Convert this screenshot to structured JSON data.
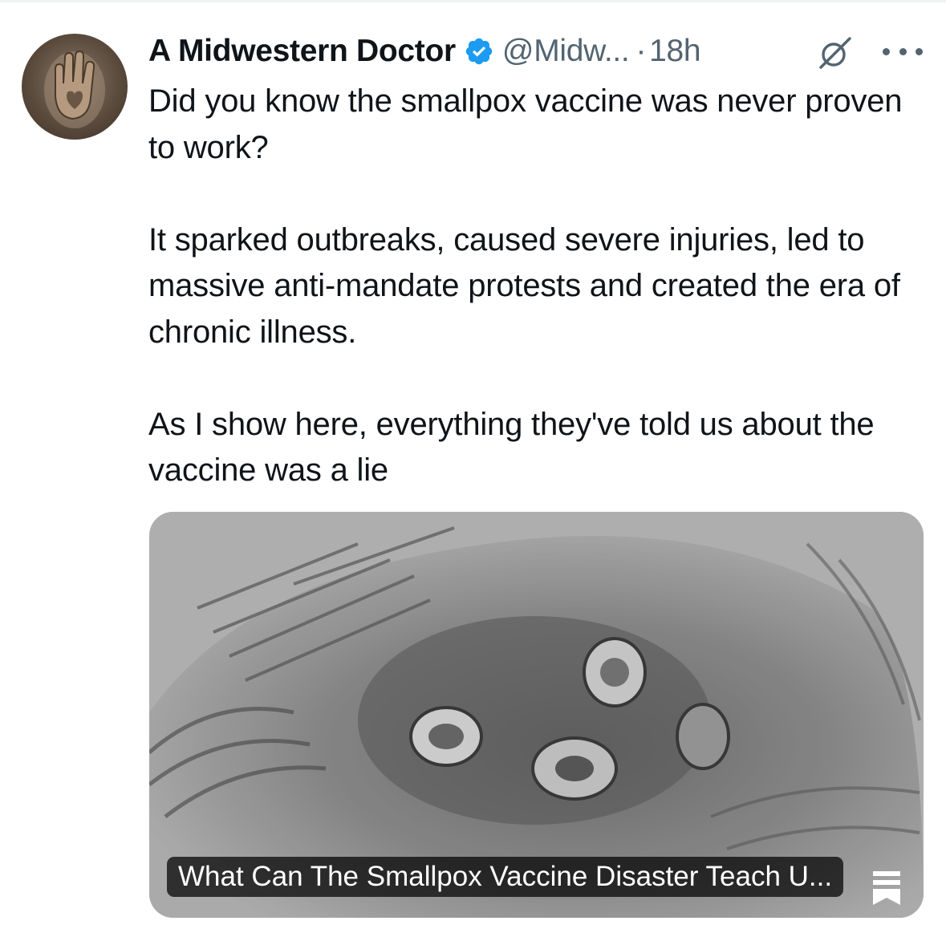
{
  "tweet": {
    "author_name": "A Midwestern Doctor",
    "handle": "@Midw...",
    "separator": "·",
    "time": "18h",
    "text": "Did you know the smallpox vaccine was never proven to work?\n\nIt sparked outbreaks, caused severe injuries, led to massive anti-mandate protests and created the era of chronic illness.\n\nAs I show here, everything they've told us about the vaccine was a lie",
    "link_card": {
      "title": "What Can The Smallpox Vaccine Disaster Teach U..."
    }
  },
  "icons": {
    "verified": "verified-badge-icon",
    "grok": "grok-icon",
    "more": "more-icon",
    "source": "substack-icon"
  },
  "colors": {
    "verified_blue": "#1d9bf0",
    "secondary_text": "#536471"
  }
}
